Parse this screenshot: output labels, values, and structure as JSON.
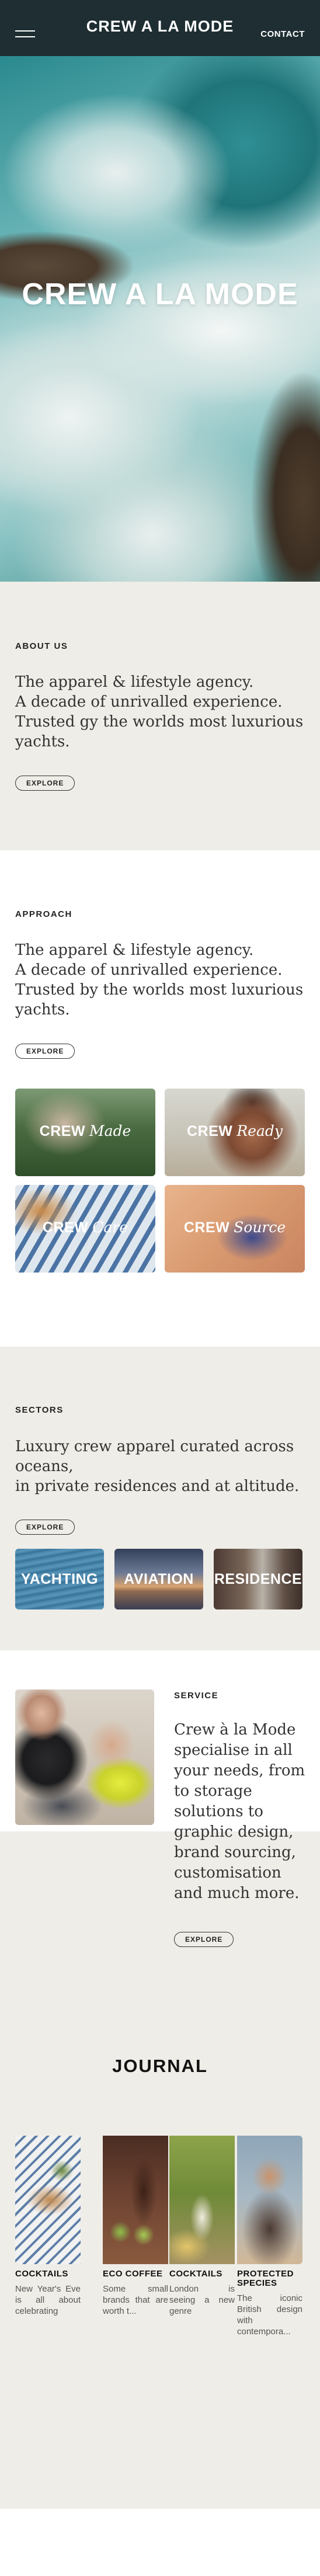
{
  "header": {
    "brand": "CREW A LA MODE",
    "contact": "CONTACT",
    "menu_icon": "hamburger-icon",
    "background": "#1e2e33"
  },
  "hero": {
    "title": "CREW A LA MODE"
  },
  "about": {
    "label": "ABOUT US",
    "text": "The apparel & lifestyle agency.\nA decade of unrivalled experience.\nTrusted gy the worlds most luxurious yachts.",
    "button": "EXPLORE"
  },
  "approach": {
    "label": "APPROACH",
    "text": "The apparel & lifestyle agency.\nA decade of unrivalled experience.\nTrusted by the worlds most luxurious yachts.",
    "button": "EXPLORE",
    "cards": [
      {
        "bold": "CREW",
        "italic": "Made"
      },
      {
        "bold": "CREW",
        "italic": "Ready"
      },
      {
        "bold": "CREW",
        "italic": "Care"
      },
      {
        "bold": "CREW",
        "italic": "Source"
      }
    ]
  },
  "sectors": {
    "label": "SECTORS",
    "text": "Luxury crew apparel curated across oceans,\nin private residences and at altitude.",
    "button": "EXPLORE",
    "tiles": [
      "YACHTING",
      "AVIATION",
      "RESIDENCE"
    ]
  },
  "service": {
    "label": "SERVICE",
    "text": "Crew à la Mode specialise in all your needs, from to storage solutions to graphic design, brand sourcing, customisation and much more.",
    "button": "EXPLORE"
  },
  "journal": {
    "title": "JOURNAL",
    "posts": [
      {
        "title": "COCKTAILS",
        "excerpt": "New Year's Eve is all about celebrating"
      },
      {
        "title": "ECO COFFEE",
        "excerpt": "Some small brands that are worth t..."
      },
      {
        "title": "COCKTAILS",
        "excerpt": "London is seeing a new genre"
      },
      {
        "title": "PROTECTED SPECIES",
        "excerpt": "The iconic British design with contempora..."
      }
    ]
  },
  "colors": {
    "section_bg": "#efede7",
    "text": "#222222"
  }
}
